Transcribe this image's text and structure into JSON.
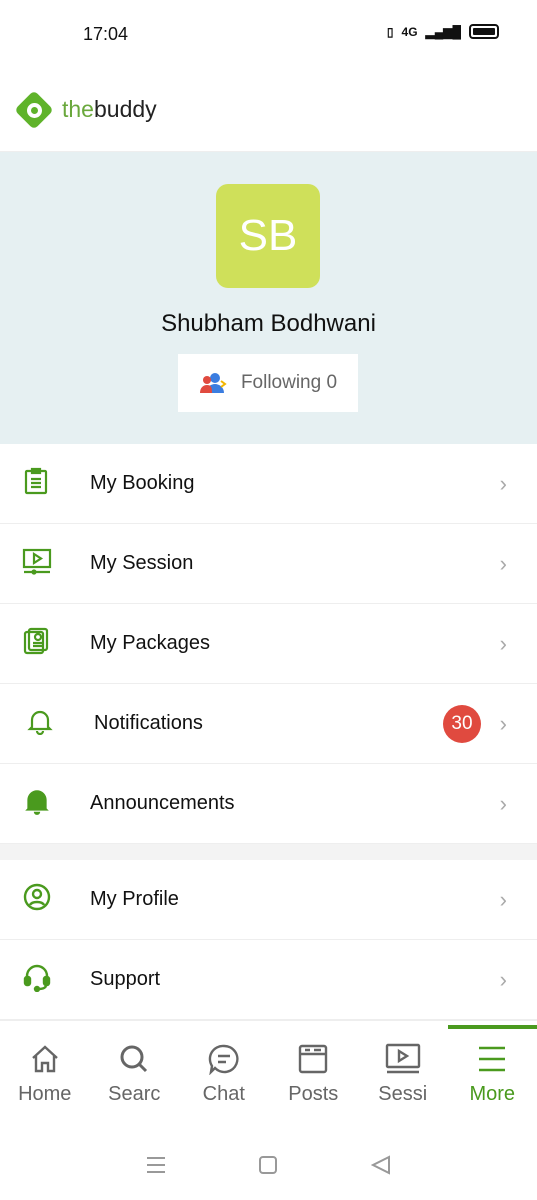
{
  "status_bar": {
    "time": "17:04",
    "network": "4G"
  },
  "brand": {
    "prefix": "the",
    "suffix": "buddy",
    "accent": "#5fb32a"
  },
  "profile": {
    "initials": "SB",
    "name": "Shubham Bodhwani",
    "following_label": "Following 0"
  },
  "menu": [
    {
      "label": "My Booking",
      "icon": "clipboard-icon"
    },
    {
      "label": "My Session",
      "icon": "video-icon"
    },
    {
      "label": "My Packages",
      "icon": "package-icon"
    },
    {
      "label": "Notifications",
      "icon": "bell-outline-icon",
      "badge": "30"
    },
    {
      "label": "Announcements",
      "icon": "bell-filled-icon"
    },
    {
      "label": "My Profile",
      "icon": "user-circle-icon"
    },
    {
      "label": "Support",
      "icon": "headset-icon"
    }
  ],
  "bottom_nav": [
    {
      "label": "Home",
      "icon": "home-icon"
    },
    {
      "label": "Searc",
      "icon": "search-icon"
    },
    {
      "label": "Chat",
      "icon": "chat-icon"
    },
    {
      "label": "Posts",
      "icon": "posts-icon"
    },
    {
      "label": "Sessi",
      "icon": "session-icon"
    },
    {
      "label": "More",
      "icon": "menu-icon",
      "active": true
    }
  ]
}
